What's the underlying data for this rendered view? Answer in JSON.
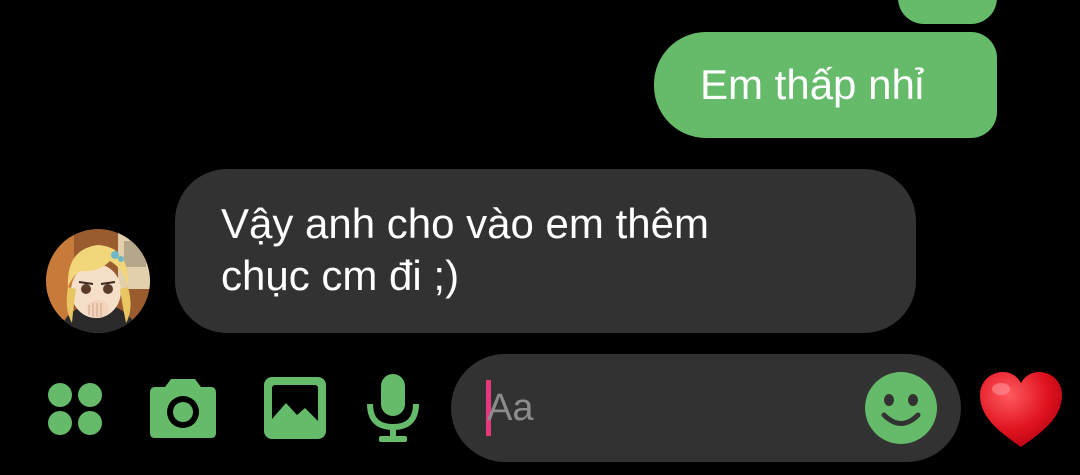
{
  "theme": {
    "accent": "#66bb6a",
    "incoming_bubble": "#323232",
    "background": "#000000",
    "caret": "#e5397a",
    "heart": "#e0131f"
  },
  "messages": [
    {
      "direction": "outgoing",
      "text": "Em thấp nhỉ"
    },
    {
      "direction": "incoming",
      "lines": [
        "Vậy anh cho vào em thêm",
        "chục cm đi ;)"
      ]
    }
  ],
  "composer": {
    "placeholder": "Aa"
  },
  "icons": {
    "more": "four-dots-icon",
    "camera": "camera-icon",
    "gallery": "image-icon",
    "voice": "microphone-icon",
    "emoji": "smiley-icon",
    "like": "heart-icon"
  }
}
